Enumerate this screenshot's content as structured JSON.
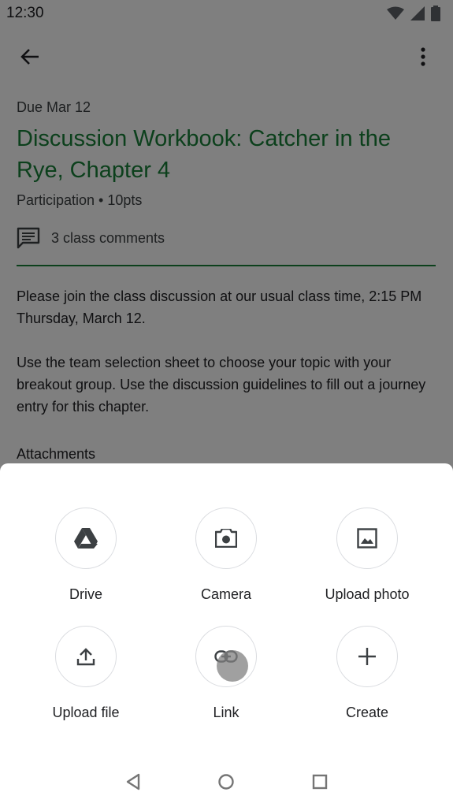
{
  "status_bar": {
    "time": "12:30"
  },
  "assignment": {
    "due": "Due Mar 12",
    "title": "Discussion Workbook: Catcher in the Rye, Chapter 4",
    "meta": "Participation • 10pts",
    "comments": "3 class comments",
    "description": [
      "Please join the class discussion at our usual class time, 2:15 PM Thursday, March 12.",
      "Use the team selection sheet to choose your topic with your breakout group. Use the discussion guidelines to fill out a journey entry for this chapter."
    ],
    "attachments_label": "Attachments"
  },
  "sheet": {
    "options": [
      {
        "label": "Drive",
        "icon": "drive-icon"
      },
      {
        "label": "Camera",
        "icon": "camera-icon"
      },
      {
        "label": "Upload photo",
        "icon": "photo-icon"
      },
      {
        "label": "Upload file",
        "icon": "upload-icon"
      },
      {
        "label": "Link",
        "icon": "link-icon"
      },
      {
        "label": "Create",
        "icon": "plus-icon"
      }
    ]
  },
  "colors": {
    "accent": "#188038",
    "scrim": "rgba(0,0,0,0.5)"
  }
}
